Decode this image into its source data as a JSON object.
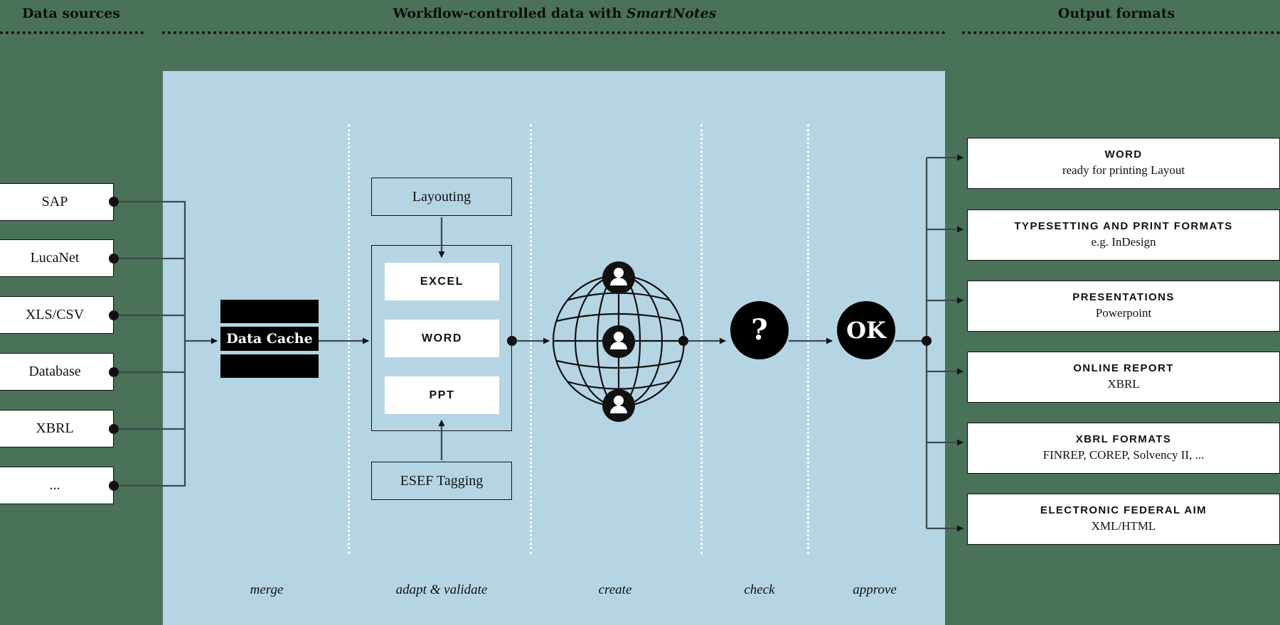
{
  "headers": {
    "left": "Data sources",
    "center_prefix": "Workflow-controlled data with ",
    "center_emphasis": "SmartNotes",
    "right": "Output formats"
  },
  "colors": {
    "background": "#4a7259",
    "panel": "#b6d5e4",
    "ink": "#111111",
    "box_fill": "#ffffff",
    "cache_fill": "#000000"
  },
  "sources": [
    {
      "label": "SAP"
    },
    {
      "label": "LucaNet"
    },
    {
      "label": "XLS/CSV"
    },
    {
      "label": "Database"
    },
    {
      "label": "XBRL"
    },
    {
      "label": "..."
    }
  ],
  "cache": {
    "label": "Data Cache"
  },
  "adapt": {
    "top_label": "Layouting",
    "bottom_label": "ESEF Tagging",
    "files": [
      "EXCEL",
      "WORD",
      "PPT"
    ]
  },
  "create": {
    "icon": "globe-icon",
    "people": 3
  },
  "check": {
    "label": "?"
  },
  "approve": {
    "label": "OK"
  },
  "phases": [
    {
      "label": "merge"
    },
    {
      "label": "adapt & validate"
    },
    {
      "label": "create"
    },
    {
      "label": "check"
    },
    {
      "label": "approve"
    }
  ],
  "outputs": [
    {
      "title": "WORD",
      "subtitle": "ready for printing Layout"
    },
    {
      "title": "TYPESETTING AND PRINT FORMATS",
      "subtitle": "e.g. InDesign"
    },
    {
      "title": "PRESENTATIONS",
      "subtitle": "Powerpoint"
    },
    {
      "title": "ONLINE REPORT",
      "subtitle": "XBRL"
    },
    {
      "title": "XBRL FORMATS",
      "subtitle": "FINREP, COREP, Solvency II, ..."
    },
    {
      "title": "ELECTRONIC FEDERAL AIM",
      "subtitle": "XML/HTML"
    }
  ]
}
